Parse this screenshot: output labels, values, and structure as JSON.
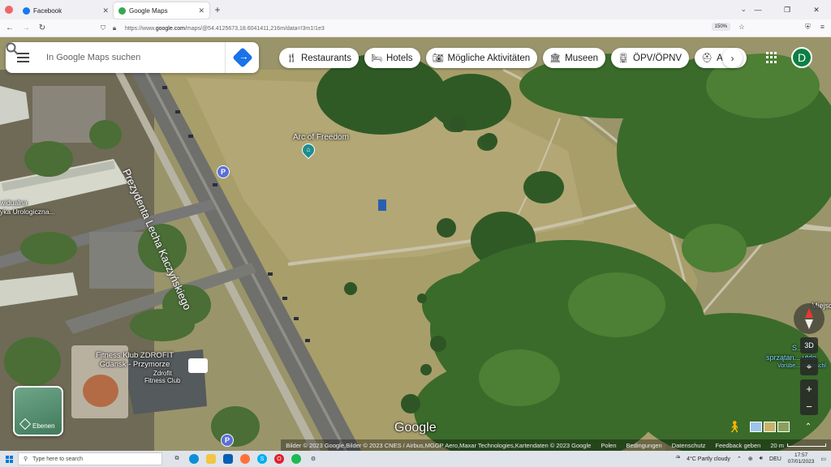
{
  "browser": {
    "tabs": [
      {
        "label": "Facebook",
        "icon": "facebook-icon",
        "color": "#1877f2",
        "active": false
      },
      {
        "label": "Google Maps",
        "icon": "maps-pin-icon",
        "color": "#34a853",
        "active": true
      }
    ],
    "url_prefix": "https://www.",
    "url_domain": "google.com",
    "url_rest": "/maps/@54.4125673,18.6041411,216m/data=!3m1!1e3",
    "zoom": "150%"
  },
  "map": {
    "search_placeholder": "In Google Maps suchen",
    "chips": [
      {
        "label": "Restaurants",
        "icon": "restaurant-icon"
      },
      {
        "label": "Hotels",
        "icon": "hotel-icon"
      },
      {
        "label": "Mögliche Aktivitäten",
        "icon": "camera-icon"
      },
      {
        "label": "Museen",
        "icon": "museum-icon"
      },
      {
        "label": "ÖPV/ÖPNV",
        "icon": "transit-icon"
      },
      {
        "label": "Ap",
        "icon": "pharmacy-icon"
      }
    ],
    "account_initial": "D",
    "street_name": "Prezydenta Lecha Kaczyńskiego",
    "place_arc": "Arc of Freedom",
    "place_clinic": "widualna\nyka Urologiczna...",
    "place_fitness_line1": "Fitness Klub ZDROFIT",
    "place_fitness_line2": "Gdansk - Przymorze",
    "place_fitness_sub1": "Zdrofit",
    "place_fitness_sub2": "Fitness Club",
    "place_right_1": "Miejsce",
    "place_right_2": "S... a z",
    "place_right_3": "sprzątan... utdo",
    "place_right_4": "Vorübe... nd geschl",
    "parking_label": "P",
    "layers_label": "Ebenen",
    "logo": "Google",
    "btn_3d": "3D",
    "zoom_in": "+",
    "zoom_out": "−",
    "attribution": "Bilder © 2023 Google,Bilder © 2023 CNES / Airbus,MGGP Aero,Maxar Technologies,Kartendaten © 2023 Google",
    "footer_links": [
      "Polen",
      "Bedingungen",
      "Datenschutz",
      "Feedback geben"
    ],
    "scale": "20 m"
  },
  "taskbar": {
    "search_placeholder": "Type here to search",
    "weather": "4°C  Partly cloudy",
    "lang": "DEU",
    "time": "17:57",
    "date": "07/01/2023"
  }
}
